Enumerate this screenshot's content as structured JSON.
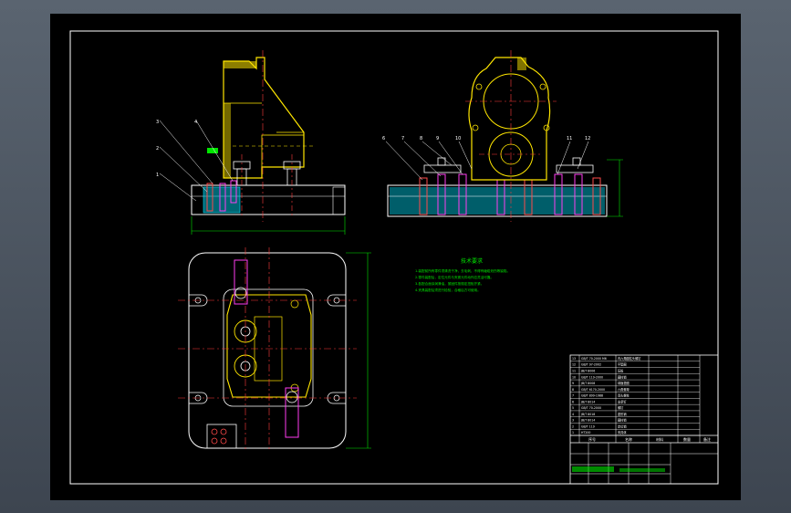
{
  "drawing": {
    "notes_title": "技术要求",
    "notes": [
      "1.装配前所有零件须清洗干净，去毛刺，不得有磕碰划伤等缺陷。",
      "2.零件装配后，定位元件与夹紧元件动作应灵活可靠。",
      "3.各配合面涂润滑油，紧固件按规定扭矩拧紧。",
      "4.夹具装配后须进行检验，合格后方可使用。"
    ],
    "balloons_front": [
      "1",
      "2",
      "3",
      "4"
    ],
    "balloons_side": [
      "6",
      "7",
      "8",
      "9",
      "10",
      "11",
      "12"
    ],
    "title_block": {
      "header_seq": "序号",
      "header_name": "名称",
      "header_material": "材料",
      "header_qty": "数量",
      "header_remark": "备注",
      "rows": [
        [
          "13",
          "GB/T 70-2000 M6",
          "内六角圆柱头螺钉"
        ],
        [
          "12",
          "GB/T 97-2002",
          "平垫圈"
        ],
        [
          "11",
          "JB/T 8006",
          "压板"
        ],
        [
          "10",
          "GB/T 119-2000",
          "圆柱销"
        ],
        [
          "9",
          "JB/T 8008",
          "球面垫圈"
        ],
        [
          "8",
          "GB/T 6170-2000",
          "六角螺母"
        ],
        [
          "7",
          "GB/T 899-1988",
          "双头螺柱"
        ],
        [
          "6",
          "JB/T 8014",
          "支承钉"
        ],
        [
          "5",
          "GB/T 70-2000",
          "螺钉"
        ],
        [
          "4",
          "JB/T 8018",
          "菱形销"
        ],
        [
          "3",
          "JB/T 8014",
          "圆柱销"
        ],
        [
          "2",
          "GB/T 119",
          "定位销"
        ],
        [
          "1",
          "HT200",
          "夹具体"
        ]
      ]
    }
  }
}
